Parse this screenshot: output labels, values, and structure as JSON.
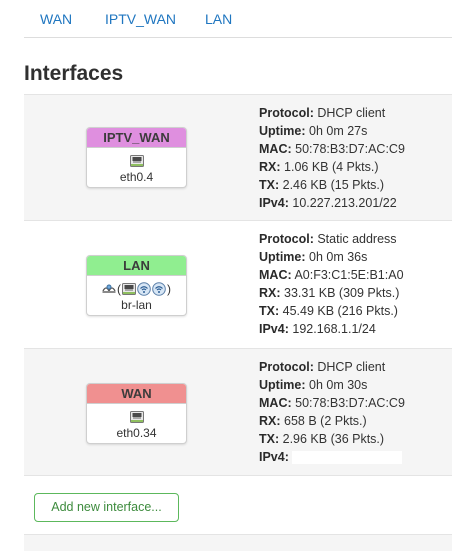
{
  "tabs": [
    {
      "label": "WAN"
    },
    {
      "label": "IPTV_WAN"
    },
    {
      "label": "LAN"
    }
  ],
  "section": {
    "title": "Interfaces"
  },
  "labels": {
    "protocol": "Protocol:",
    "uptime": "Uptime:",
    "mac": "MAC:",
    "rx": "RX:",
    "tx": "TX:",
    "ipv4": "IPv4:"
  },
  "interfaces": [
    {
      "name": "IPTV_WAN",
      "color": "#df8fdf",
      "device": "eth0.4",
      "protocol": "DHCP client",
      "uptime": "0h 0m 27s",
      "mac": "50:78:B3:D7:AC:C9",
      "rx": "1.06 KB (4 Pkts.)",
      "tx": "2.46 KB (15 Pkts.)",
      "ipv4": "10.227.213.201/22"
    },
    {
      "name": "LAN",
      "color": "#90ee90",
      "device": "br-lan",
      "protocol": "Static address",
      "uptime": "0h 0m 36s",
      "mac": "A0:F3:C1:5E:B1:A0",
      "rx": "33.31 KB (309 Pkts.)",
      "tx": "45.49 KB (216 Pkts.)",
      "ipv4": "192.168.1.1/24"
    },
    {
      "name": "WAN",
      "color": "#f09090",
      "device": "eth0.34",
      "protocol": "DHCP client",
      "uptime": "0h 0m 30s",
      "mac": "50:78:B3:D7:AC:C9",
      "rx": "658 B (2 Pkts.)",
      "tx": "2.96 KB (36 Pkts.)",
      "ipv4": ""
    }
  ],
  "icons": {
    "ethernet": "ethernet-port-icon",
    "bridge": "bridge-icon",
    "wifi": "wireless-icon"
  },
  "add_button": {
    "label": "Add new interface..."
  }
}
